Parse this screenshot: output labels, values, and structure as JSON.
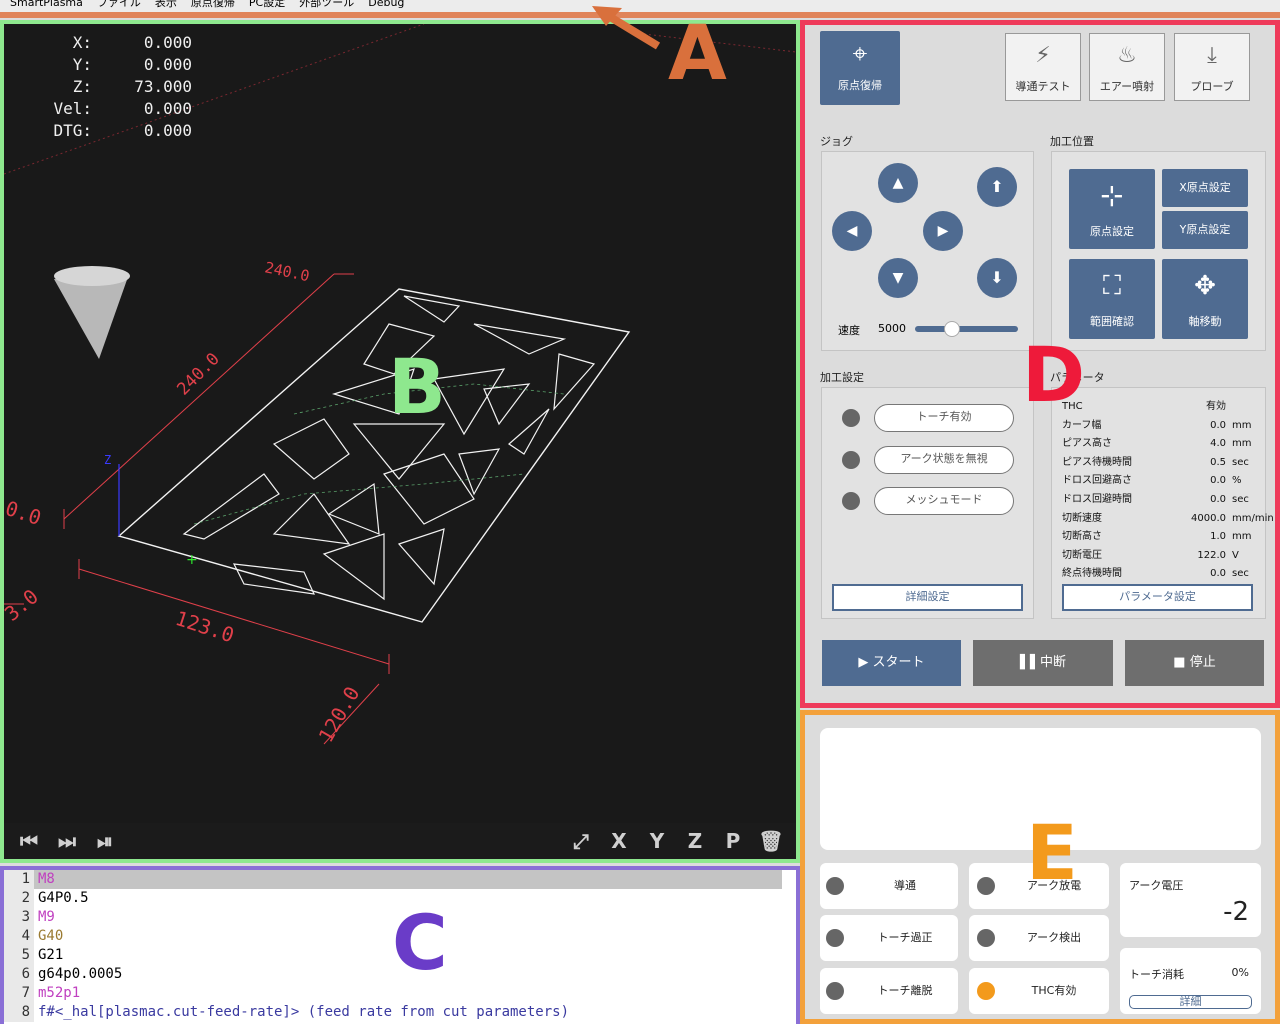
{
  "menu": [
    "SmartPlasma",
    "ファイル",
    "表示",
    "原点復帰",
    "PC設定",
    "外部ツール",
    "Debug"
  ],
  "dro": [
    {
      "label": "X:",
      "value": "0.000"
    },
    {
      "label": "Y:",
      "value": "0.000"
    },
    {
      "label": "Z:",
      "value": "73.000"
    },
    {
      "label": "Vel:",
      "value": "0.000"
    },
    {
      "label": "DTG:",
      "value": "0.000"
    }
  ],
  "viewport": {
    "dims": {
      "d1": "240.0",
      "d2": "240.0",
      "d3": "123.0",
      "d4": "120.0",
      "d5": "3.0",
      "d6": "0.0"
    },
    "toolbar": [
      "first-icon",
      "next-icon",
      "step-icon",
      "fit-icon",
      "view-x-icon",
      "view-y-icon",
      "view-z-icon",
      "view-p-icon",
      "clear-icon"
    ],
    "toolbar_text": {
      "vx": "X",
      "vy": "Y",
      "vz": "Z",
      "vp": "P"
    }
  },
  "code": [
    {
      "n": "1",
      "t": "M8"
    },
    {
      "n": "2",
      "t": "G4P0.5"
    },
    {
      "n": "3",
      "t": "M9"
    },
    {
      "n": "4",
      "t": "G40"
    },
    {
      "n": "5",
      "t": "G21"
    },
    {
      "n": "6",
      "t": "g64p0.0005"
    },
    {
      "n": "7",
      "t": "m52p1"
    },
    {
      "n": "8",
      "t": "f#<_hal[plasmac.cut-feed-rate]> (feed rate from cut parameters)"
    }
  ],
  "top": {
    "home": "原点復帰",
    "continuity": "導通テスト",
    "air": "エアー噴射",
    "probe": "プローブ"
  },
  "jog": {
    "title": "ジョグ",
    "speed_label": "速度",
    "speed_value": "5000",
    "speed_fraction": 0.36
  },
  "pos": {
    "title": "加工位置",
    "set_origin": "原点設定",
    "x_origin": "X原点設定",
    "y_origin": "Y原点設定",
    "range": "範囲確認",
    "move": "軸移動"
  },
  "settings": {
    "title": "加工設定",
    "torch": "トーチ有効",
    "ignore_arc": "アーク状態を無視",
    "mesh": "メッシュモード",
    "detail": "詳細設定"
  },
  "params": {
    "title": "パラメータ",
    "rows": [
      {
        "name": "THC",
        "value": "有効",
        "unit": ""
      },
      {
        "name": "カーフ幅",
        "value": "0.0",
        "unit": "mm"
      },
      {
        "name": "ピアス高さ",
        "value": "4.0",
        "unit": "mm"
      },
      {
        "name": "ピアス待機時間",
        "value": "0.5",
        "unit": "sec"
      },
      {
        "name": "ドロス回避高さ",
        "value": "0.0",
        "unit": "%"
      },
      {
        "name": "ドロス回避時間",
        "value": "0.0",
        "unit": "sec"
      },
      {
        "name": "切断速度",
        "value": "4000.0",
        "unit": "mm/min"
      },
      {
        "name": "切断高さ",
        "value": "1.0",
        "unit": "mm"
      },
      {
        "name": "切断電圧",
        "value": "122.0",
        "unit": "V"
      },
      {
        "name": "終点待機時間",
        "value": "0.0",
        "unit": "sec"
      }
    ],
    "button": "パラメータ設定"
  },
  "actions": {
    "start": "▶ スタート",
    "pause": "▌▌中断",
    "stop": "■ 停止"
  },
  "status": {
    "continuity": "導通",
    "arc_discharge": "アーク放電",
    "torch_over": "トーチ過正",
    "arc_detect": "アーク検出",
    "torch_off": "トーチ離脱",
    "thc_enabled": "THC有効",
    "arc_voltage_label": "アーク電圧",
    "arc_voltage": "-2",
    "torch_wear_label": "トーチ消耗",
    "torch_wear": "0%",
    "detail": "詳細"
  },
  "annotations": {
    "a": "A",
    "b": "B",
    "c": "C",
    "d": "D",
    "e": "E"
  },
  "colors": {
    "accent": "#4f6b91",
    "zoneA": "#e0845a",
    "zoneB": "#8ee88e",
    "zoneC": "#8a6fd6",
    "zoneD": "#ee3a5a",
    "zoneE": "#f3a13b",
    "led_on": "#f39a1c",
    "led_off": "#666666"
  }
}
